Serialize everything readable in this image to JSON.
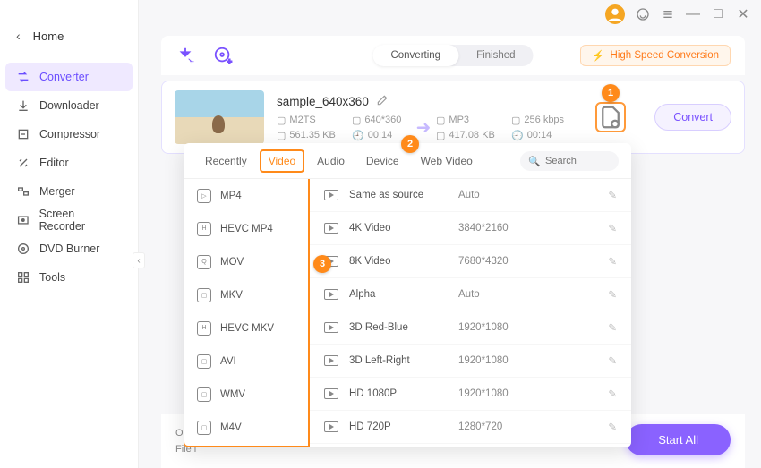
{
  "titlebar": {
    "minimize": "—",
    "maximize": "□",
    "close": "✕"
  },
  "sidebar": {
    "home": "Home",
    "items": [
      {
        "label": "Converter",
        "icon": "converter"
      },
      {
        "label": "Downloader",
        "icon": "download"
      },
      {
        "label": "Compressor",
        "icon": "compress"
      },
      {
        "label": "Editor",
        "icon": "editor"
      },
      {
        "label": "Merger",
        "icon": "merger"
      },
      {
        "label": "Screen Recorder",
        "icon": "recorder"
      },
      {
        "label": "DVD Burner",
        "icon": "dvd"
      },
      {
        "label": "Tools",
        "icon": "tools"
      }
    ]
  },
  "main_tabs": {
    "converting": "Converting",
    "finished": "Finished"
  },
  "hispeed": "High Speed Conversion",
  "file": {
    "name": "sample_640x360",
    "src": {
      "format": "M2TS",
      "res": "640*360",
      "size": "561.35 KB",
      "dur": "00:14"
    },
    "dst": {
      "format": "MP3",
      "bitrate": "256 kbps",
      "size": "417.08 KB",
      "dur": "00:14"
    },
    "convert_label": "Convert"
  },
  "badges": {
    "one": "1",
    "two": "2",
    "three": "3"
  },
  "format_panel": {
    "tabs": [
      "Recently",
      "Video",
      "Audio",
      "Device",
      "Web Video"
    ],
    "active_tab": 1,
    "search_placeholder": "Search",
    "formats": [
      "MP4",
      "HEVC MP4",
      "MOV",
      "MKV",
      "HEVC MKV",
      "AVI",
      "WMV",
      "M4V"
    ],
    "presets": [
      {
        "name": "Same as source",
        "res": "Auto"
      },
      {
        "name": "4K Video",
        "res": "3840*2160"
      },
      {
        "name": "8K Video",
        "res": "7680*4320"
      },
      {
        "name": "Alpha",
        "res": "Auto"
      },
      {
        "name": "3D Red-Blue",
        "res": "1920*1080"
      },
      {
        "name": "3D Left-Right",
        "res": "1920*1080"
      },
      {
        "name": "HD 1080P",
        "res": "1920*1080"
      },
      {
        "name": "HD 720P",
        "res": "1280*720"
      }
    ]
  },
  "bottom": {
    "output": "Outp",
    "filelist": "File l",
    "start_all": "Start All"
  }
}
